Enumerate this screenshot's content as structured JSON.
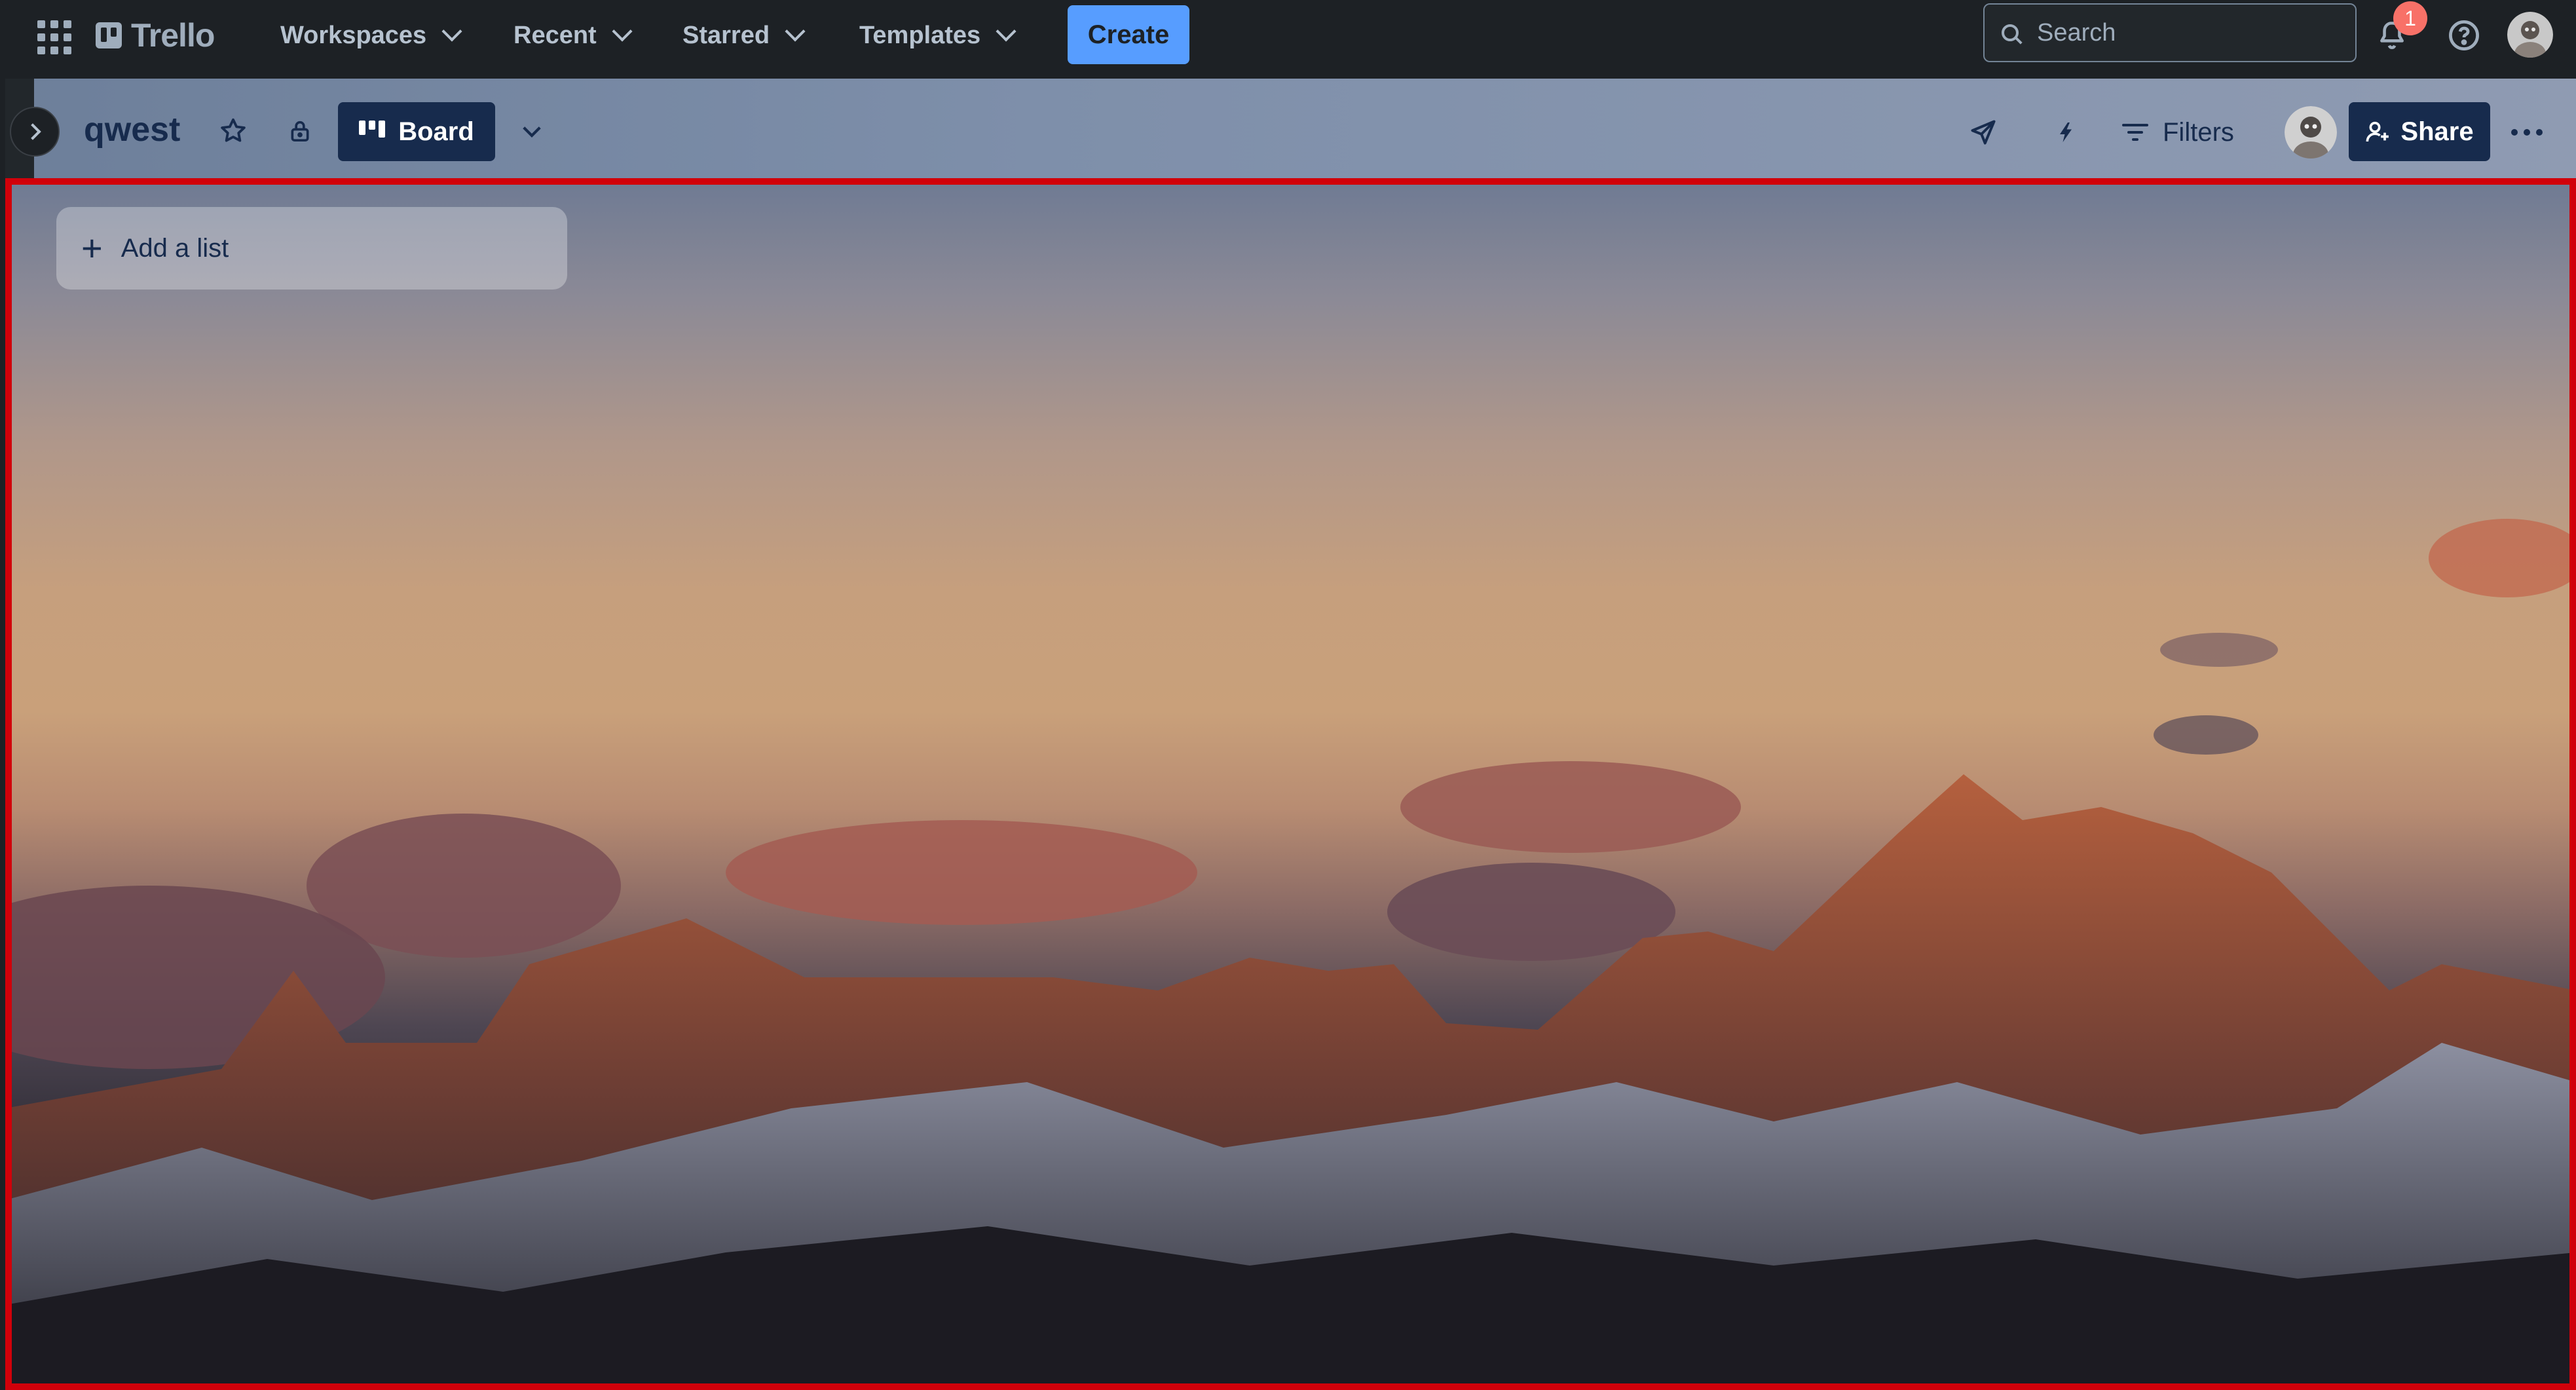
{
  "topbar": {
    "app_name": "Trello",
    "nav": [
      "Workspaces",
      "Recent",
      "Starred",
      "Templates"
    ],
    "create_label": "Create",
    "search_placeholder": "Search",
    "notification_count": "1"
  },
  "board": {
    "title": "qwest",
    "view_label": "Board",
    "filters_label": "Filters",
    "share_label": "Share"
  },
  "canvas": {
    "add_list_label": "Add a list"
  },
  "colors": {
    "topbar_bg": "#1d2125",
    "create_button": "#579dff",
    "share_button": "#172b4d",
    "notification_badge": "#f87168",
    "highlight_frame": "#d1000a"
  },
  "icons": [
    "apps-grid-icon",
    "trello-logo-icon",
    "search-icon",
    "notification-bell-icon",
    "help-icon",
    "avatar",
    "chevron-right-icon",
    "star-icon",
    "lock-icon",
    "board-icon",
    "chevron-down-icon",
    "send-icon",
    "lightning-icon",
    "filter-icon",
    "add-person-icon",
    "more-icon",
    "plus-icon"
  ]
}
